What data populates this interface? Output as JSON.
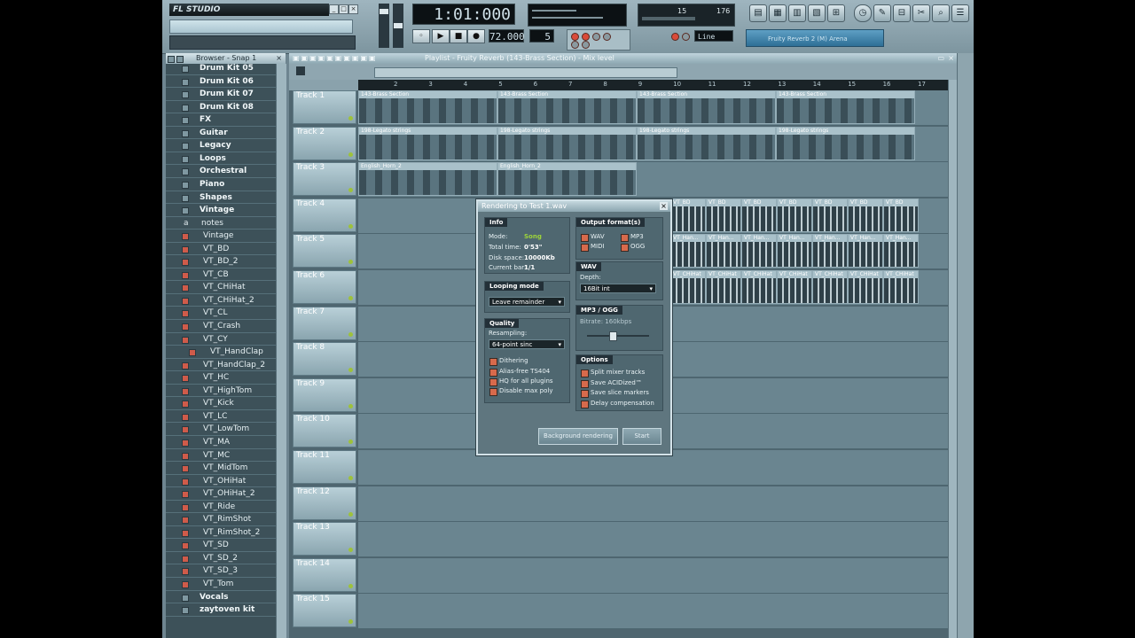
{
  "app": {
    "logo": "FL STUDIO"
  },
  "toolbar": {
    "time": "1:01:000",
    "tempo": "72.000",
    "pattern": "5",
    "line_mode": "Line",
    "perf_left": "15",
    "perf_right": "176",
    "plugin_label": "Fruity Reverb 2 (M) Arena"
  },
  "browser": {
    "title": "Browser - Snap 1",
    "items": [
      {
        "label": "Drum Kit 05",
        "type": "folder"
      },
      {
        "label": "Drum Kit 06",
        "type": "folder"
      },
      {
        "label": "Drum Kit 07",
        "type": "folder"
      },
      {
        "label": "Drum Kit 08",
        "type": "folder"
      },
      {
        "label": "FX",
        "type": "folder"
      },
      {
        "label": "Guitar",
        "type": "folder"
      },
      {
        "label": "Legacy",
        "type": "folder"
      },
      {
        "label": "Loops",
        "type": "folder"
      },
      {
        "label": "Orchestral",
        "type": "folder"
      },
      {
        "label": "Piano",
        "type": "folder"
      },
      {
        "label": "Shapes",
        "type": "folder"
      },
      {
        "label": "Vintage",
        "type": "folder"
      },
      {
        "label": "notes",
        "type": "file"
      },
      {
        "label": "Vintage",
        "type": "sub"
      },
      {
        "label": "VT_BD",
        "type": "sub"
      },
      {
        "label": "VT_BD_2",
        "type": "sub"
      },
      {
        "label": "VT_CB",
        "type": "sub"
      },
      {
        "label": "VT_CHiHat",
        "type": "sub"
      },
      {
        "label": "VT_CHiHat_2",
        "type": "sub"
      },
      {
        "label": "VT_CL",
        "type": "sub"
      },
      {
        "label": "VT_Crash",
        "type": "sub"
      },
      {
        "label": "VT_CY",
        "type": "sub"
      },
      {
        "label": "VT_HandClap",
        "type": "subsub"
      },
      {
        "label": "VT_HandClap_2",
        "type": "sub"
      },
      {
        "label": "VT_HC",
        "type": "sub"
      },
      {
        "label": "VT_HighTom",
        "type": "sub"
      },
      {
        "label": "VT_Kick",
        "type": "sub"
      },
      {
        "label": "VT_LC",
        "type": "sub"
      },
      {
        "label": "VT_LowTom",
        "type": "sub"
      },
      {
        "label": "VT_MA",
        "type": "sub"
      },
      {
        "label": "VT_MC",
        "type": "sub"
      },
      {
        "label": "VT_MidTom",
        "type": "sub"
      },
      {
        "label": "VT_OHiHat",
        "type": "sub"
      },
      {
        "label": "VT_OHiHat_2",
        "type": "sub"
      },
      {
        "label": "VT_Ride",
        "type": "sub"
      },
      {
        "label": "VT_RimShot",
        "type": "sub"
      },
      {
        "label": "VT_RimShot_2",
        "type": "sub"
      },
      {
        "label": "VT_SD",
        "type": "sub"
      },
      {
        "label": "VT_SD_2",
        "type": "sub"
      },
      {
        "label": "VT_SD_3",
        "type": "sub"
      },
      {
        "label": "VT_Tom",
        "type": "sub"
      },
      {
        "label": "Vocals",
        "type": "folder"
      },
      {
        "label": "zaytoven kit",
        "type": "folder"
      }
    ]
  },
  "playlist": {
    "title": "Playlist - Fruity Reverb (143-Brass Section) - Mix level",
    "ruler": [
      "2",
      "3",
      "4",
      "5",
      "6",
      "7",
      "8",
      "9",
      "10",
      "11",
      "12",
      "13",
      "14",
      "15",
      "16",
      "17"
    ],
    "tracks": [
      "Track 1",
      "Track 2",
      "Track 3",
      "Track 4",
      "Track 5",
      "Track 6",
      "Track 7",
      "Track 8",
      "Track 9",
      "Track 10",
      "Track 11",
      "Track 12",
      "Track 13",
      "Track 14",
      "Track 15"
    ],
    "clip_names": {
      "brass": "143-Brass Section",
      "strings": "198-Legato strings",
      "horn": "English_Horn_2",
      "bd": "VT_BD",
      "han": "VT_Han...",
      "chi": "VT_CHiHat"
    }
  },
  "render_dialog": {
    "title": "Rendering to Test 1.wav",
    "info": {
      "heading": "Info",
      "mode_label": "Mode:",
      "mode_value": "Song",
      "total_label": "Total time:",
      "total_value": "0'53\"",
      "disk_label": "Disk space:",
      "disk_value": "10000Kb",
      "bar_label": "Current bar:",
      "bar_value": "1/1"
    },
    "output_formats": {
      "heading": "Output format(s)",
      "items": [
        "WAV",
        "MP3",
        "MIDI",
        "OGG"
      ]
    },
    "looping": {
      "heading": "Looping mode",
      "value": "Leave remainder"
    },
    "wav": {
      "heading": "WAV",
      "depth_label": "Depth:",
      "depth_value": "16Bit int"
    },
    "quality": {
      "heading": "Quality",
      "resampling_label": "Resampling:",
      "resampling_value": "64-point sinc",
      "options": [
        "Dithering",
        "Alias-free TS404",
        "HQ for all plugins",
        "Disable max poly"
      ]
    },
    "mp3": {
      "heading": "MP3 / OGG",
      "bitrate_label": "Bitrate: 160kbps",
      "bitrate_fraction": 0.35
    },
    "options": {
      "heading": "Options",
      "items": [
        "Split mixer tracks",
        "Save ACIDized™",
        "Save slice markers",
        "Delay compensation"
      ]
    },
    "buttons": {
      "background": "Background rendering",
      "start": "Start"
    }
  }
}
